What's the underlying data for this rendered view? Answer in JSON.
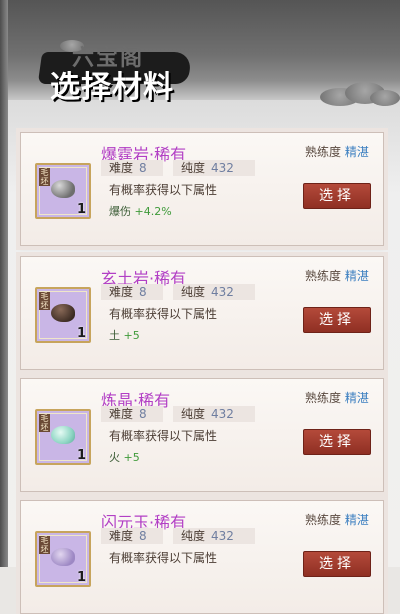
{
  "header": {
    "title": "选择材料",
    "title_shadow": "六宝阁"
  },
  "common": {
    "difficulty_label": "难度",
    "purity_label": "纯度",
    "mastery_label": "熟练度",
    "desc": "有概率获得以下属性",
    "select_label": "选择"
  },
  "cards": [
    {
      "name": "爆霆岩·稀有",
      "difficulty": "8",
      "purity": "432",
      "mastery": "精湛",
      "bonus_label": "爆伤",
      "bonus_value": "+4.2%",
      "tag": "毛坯",
      "qty": "1",
      "icon": "gray-rock-icon"
    },
    {
      "name": "玄土岩·稀有",
      "difficulty": "8",
      "purity": "432",
      "mastery": "精湛",
      "bonus_label": "土",
      "bonus_value": "+5",
      "tag": "毛坯",
      "qty": "1",
      "icon": "brown-rock-icon"
    },
    {
      "name": "炼晶·稀有",
      "difficulty": "8",
      "purity": "432",
      "mastery": "精湛",
      "bonus_label": "火",
      "bonus_value": "+5",
      "tag": "毛坯",
      "qty": "1",
      "icon": "crystal-icon"
    },
    {
      "name": "闪元玉·稀有",
      "difficulty": "8",
      "purity": "432",
      "mastery": "精湛",
      "bonus_label": "",
      "bonus_value": "",
      "tag": "毛坯",
      "qty": "1",
      "icon": "jade-icon"
    }
  ],
  "colors": {
    "rarity": "#b23fc5",
    "accent_blue": "#3c7fc0",
    "button": "#9e3a2d",
    "bonus_green": "#3f9a3a"
  }
}
